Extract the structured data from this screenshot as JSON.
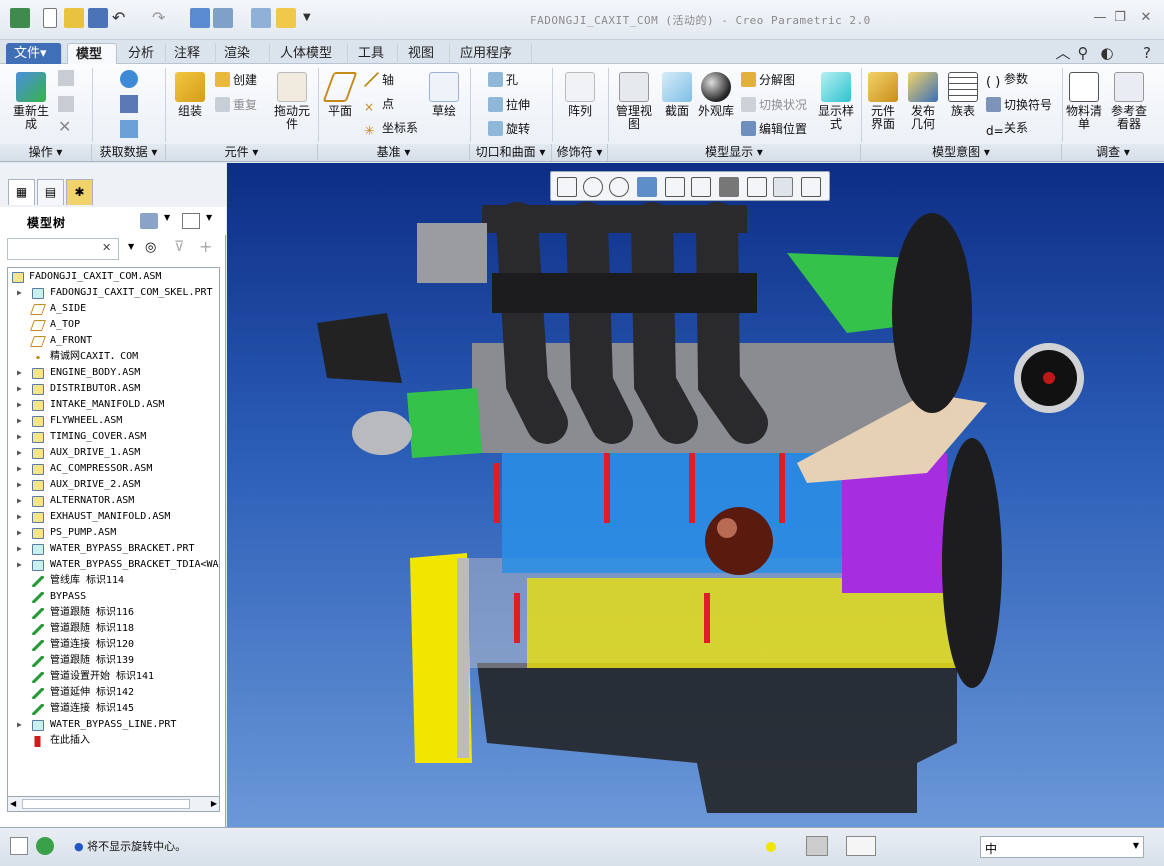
{
  "window": {
    "title": "FADONGJI_CAXIT_COM (活动的) - Creo Parametric 2.0",
    "controls": [
      "minimize",
      "restore",
      "close"
    ]
  },
  "menu": {
    "tabs": [
      "文件",
      "模型",
      "分析",
      "注释",
      "渲染",
      "人体模型",
      "工具",
      "视图",
      "应用程序"
    ],
    "active_tab": "模型",
    "file_arrow": "▾"
  },
  "ribbon": {
    "groups": [
      "操作",
      "获取数据",
      "元件",
      "基准",
      "切口和曲面",
      "修饰符",
      "模型显示",
      "模型意图",
      "调查"
    ],
    "group_arrow": "▾",
    "regenerate": "重新生成",
    "assemble": "组装",
    "create": "创建",
    "repeat": "重复",
    "drag": "拖动元件",
    "plane": "平面",
    "axis": "轴",
    "point": "点",
    "csys": "坐标系",
    "sketch": "草绘",
    "hole": "孔",
    "extrude": "拉伸",
    "revolve": "旋转",
    "pattern": "阵列",
    "manage_views": "管理视图",
    "section": "截面",
    "appearance": "外观库",
    "explode": "分解图",
    "toggle_status": "切换状况",
    "edit_position": "编辑位置",
    "display_style": "显示样式",
    "component_interface": "元件界面",
    "publish_geometry": "发布几何",
    "family_table": "族表",
    "parameters": "参数",
    "switch_symbols": "切换符号",
    "relations": "关系",
    "bom": "物料清单",
    "reference_viewer": "参考查看器"
  },
  "model_tree": {
    "title": "模型树",
    "search_value": "",
    "items": [
      {
        "label": "FADONGJI_CAXIT_COM.ASM",
        "type": "asm",
        "expand": ""
      },
      {
        "label": "FADONGJI_CAXIT_COM_SKEL.PRT",
        "type": "prt",
        "expand": "▶"
      },
      {
        "label": "A_SIDE",
        "type": "plane",
        "expand": ""
      },
      {
        "label": "A_TOP",
        "type": "plane",
        "expand": ""
      },
      {
        "label": "A_FRONT",
        "type": "plane",
        "expand": ""
      },
      {
        "label": "精诚网CAXIT．COM",
        "type": "csys",
        "expand": ""
      },
      {
        "label": "ENGINE_BODY.ASM",
        "type": "asm",
        "expand": "▶"
      },
      {
        "label": "DISTRIBUTOR.ASM",
        "type": "asm",
        "expand": "▶"
      },
      {
        "label": "INTAKE_MANIFOLD.ASM",
        "type": "asm",
        "expand": "▶"
      },
      {
        "label": "FLYWHEEL.ASM",
        "type": "asm",
        "expand": "▶"
      },
      {
        "label": "TIMING_COVER.ASM",
        "type": "asm",
        "expand": "▶"
      },
      {
        "label": "AUX_DRIVE_1.ASM",
        "type": "asm",
        "expand": "▶"
      },
      {
        "label": "AC_COMPRESSOR.ASM",
        "type": "asm",
        "expand": "▶"
      },
      {
        "label": "AUX_DRIVE_2.ASM",
        "type": "asm",
        "expand": "▶"
      },
      {
        "label": "ALTERNATOR.ASM",
        "type": "asm",
        "expand": "▶"
      },
      {
        "label": "EXHAUST_MANIFOLD.ASM",
        "type": "asm",
        "expand": "▶"
      },
      {
        "label": "PS_PUMP.ASM",
        "type": "asm",
        "expand": "▶"
      },
      {
        "label": "WATER_BYPASS_BRACKET.PRT",
        "type": "prt",
        "expand": "▶"
      },
      {
        "label": "WATER_BYPASS_BRACKET_TDIA<WA",
        "type": "prt",
        "expand": "▶"
      },
      {
        "label": "管线库 标识114",
        "type": "pipe",
        "expand": ""
      },
      {
        "label": "BYPASS",
        "type": "pipe",
        "expand": ""
      },
      {
        "label": "管道跟随 标识116",
        "type": "pipe",
        "expand": ""
      },
      {
        "label": "管道跟随 标识118",
        "type": "pipe",
        "expand": ""
      },
      {
        "label": "管道连接 标识120",
        "type": "pipe",
        "expand": ""
      },
      {
        "label": "管道跟随 标识139",
        "type": "pipe",
        "expand": ""
      },
      {
        "label": "管道设置开始 标识141",
        "type": "pipe",
        "expand": ""
      },
      {
        "label": "管道延伸 标识142",
        "type": "pipe",
        "expand": ""
      },
      {
        "label": "管道连接 标识145",
        "type": "pipe",
        "expand": ""
      },
      {
        "label": "WATER_BYPASS_LINE.PRT",
        "type": "prt",
        "expand": "▶"
      },
      {
        "label": "在此插入",
        "type": "insert",
        "expand": ""
      }
    ]
  },
  "status": {
    "message": "将不显示旋转中心。",
    "lang_label": "中"
  },
  "colors": {
    "viewport_top": "#0d2d86",
    "viewport_bottom": "#6b98d8",
    "blue_block": "#2a8fe8",
    "yellow_part": "#f2e600",
    "green_part": "#35c24a",
    "purple_part": "#a62de0"
  }
}
